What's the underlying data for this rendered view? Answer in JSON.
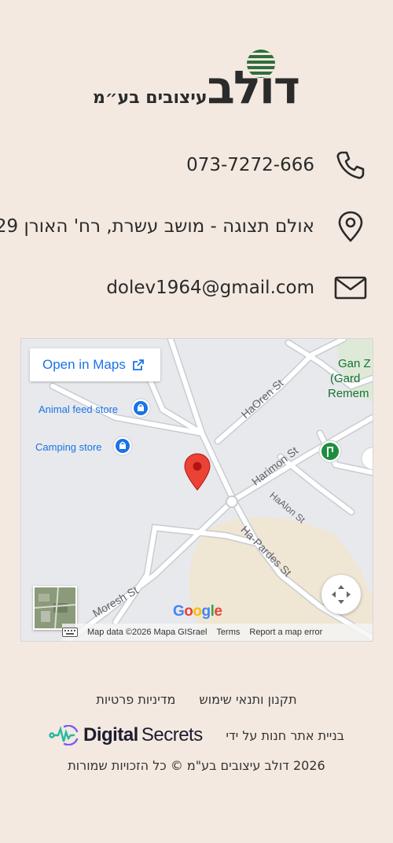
{
  "logo": {
    "main": "דולב",
    "sub": "עיצובים בע״מ"
  },
  "contact": {
    "phone": "073-7272-666",
    "address": "אולם תצוגה - מושב עשרת, רח' האורן 29",
    "email": "dolev1964@gmail.com"
  },
  "map": {
    "open_in_maps": "Open in Maps",
    "pois": {
      "animal_feed": "Animal feed store",
      "camping": "Camping store"
    },
    "streets": {
      "haoren": "HaOren St",
      "harimon": "Harimon St",
      "haalon": "HaAlon St",
      "hapardes": "Ha-Pardes St",
      "moresh": "Moresh St"
    },
    "garden_label_1": "Gan Z",
    "garden_label_2": "(Gard",
    "garden_label_3": "Remem",
    "google": "Google",
    "attribution": {
      "data": "Map data ©2026 Mapa GISrael",
      "terms": "Terms",
      "report": "Report a map error"
    },
    "colors": {
      "background": "#e8e9ec",
      "road": "#ffffff",
      "road_edge": "#c8ccd2",
      "sand": "#efe6d3",
      "green": "#cfe7c4",
      "pin": "#ea4335",
      "poi_blue": "#1a73e8",
      "poi_green": "#137333"
    }
  },
  "footer": {
    "terms": "תקנון ותנאי שימוש",
    "privacy": "מדיניות פרטיות",
    "builder_text": "בניית אתר חנות על ידי",
    "builder_brand_bold": "Digital",
    "builder_brand_light": "Secrets",
    "copyright": "2026 דולב עיצובים בע\"מ © כל הזכויות שמורות"
  }
}
